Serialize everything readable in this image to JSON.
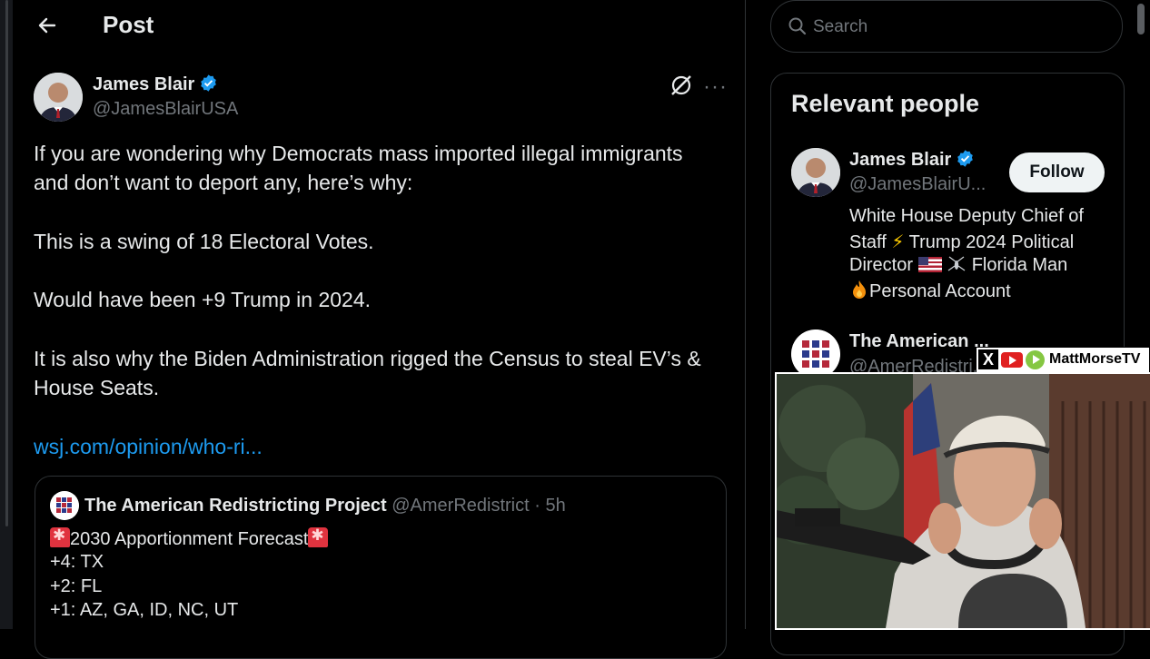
{
  "header": {
    "title": "Post"
  },
  "post": {
    "author_name": "James Blair",
    "author_handle": "@JamesBlairUSA",
    "more_label": "···",
    "lines": [
      "If you are wondering why Democrats mass imported illegal immigrants",
      "and don’t want to deport any, here’s why:",
      "This is a swing of 18 Electoral Votes.",
      "Would have been +9 Trump in 2024.",
      "It is also why the Biden Administration rigged the Census to steal EV’s &",
      "House Seats."
    ],
    "link": "wsj.com/opinion/who-ri...",
    "quote": {
      "name": "The American Redistricting Project",
      "meta": "@AmerRedistrict · 5h",
      "title": "2030 Apportionment Forecast",
      "lines": [
        "+4:  TX",
        "+2: FL",
        "+1:  AZ, GA, ID, NC, UT"
      ]
    }
  },
  "sidebar": {
    "search_placeholder": "Search",
    "relevant_title": "Relevant people",
    "person1": {
      "name": "James Blair",
      "handle": "@JamesBlairU...",
      "follow_label": "Follow",
      "bio_line1": "White House Deputy Chief of",
      "bio_line2_a": "Staff",
      "bio_line2_b": "Trump 2024 Political",
      "bio_line3_a": "Director",
      "bio_line3_b": "Florida Man",
      "bio_line4": "Personal Account"
    },
    "person2": {
      "name": "The American ...",
      "handle": "@AmerRedistri..."
    }
  },
  "overlay": {
    "x_label": "X",
    "channel": "MattMorseTV"
  },
  "colors": {
    "background": "#000000",
    "accent_link": "#1d9bf0",
    "verified": "#1d9bf0",
    "muted": "#71767b"
  }
}
